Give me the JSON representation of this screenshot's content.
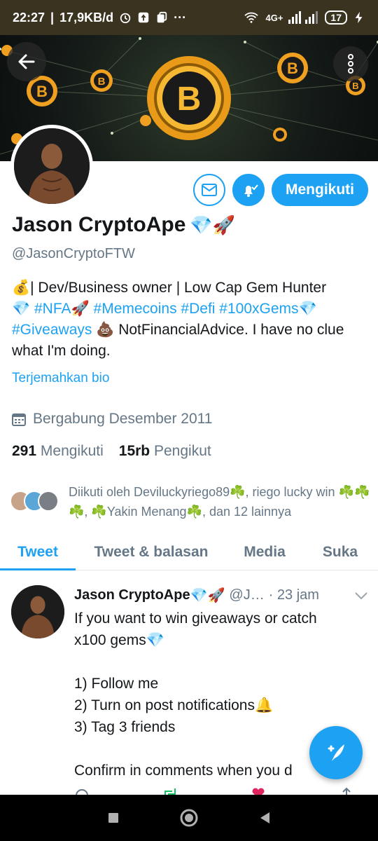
{
  "status_bar": {
    "time": "22:27",
    "net_speed": "17,9KB/d",
    "dots": "···",
    "network": "4G+",
    "battery": "17"
  },
  "banner": {
    "coin_letter": "B"
  },
  "profile": {
    "name": "Jason CryptoApe",
    "name_emojis": "💎🚀",
    "handle": "@JasonCryptoFTW",
    "follow_label": "Mengikuti",
    "bio_line1": "💰| Dev/Business owner | Low Cap Gem Hunter",
    "bio_line2_start": "💎",
    "bio_tag_nfa": "#NFA🚀",
    "bio_tag_memecoins": "#Memecoins",
    "bio_tag_defi": "#Defi",
    "bio_tag_100x": "#100xGems💎",
    "bio_tag_giveaways": "#Giveaways",
    "bio_tail": "💩 NotFinancialAdvice. I have no clue what I'm doing.",
    "translate_label": "Terjemahkan bio",
    "joined": "Bergabung Desember 2011",
    "following_count": "291",
    "following_label": "Mengikuti",
    "followers_count": "15rb",
    "followers_label": "Pengikut",
    "followed_by": "Diikuti oleh Deviluckyriego89☘️, riego lucky win ☘️☘️☘️, ☘️Yakin Menang☘️, dan 12 lainnya"
  },
  "tabs": [
    "Tweet",
    "Tweet & balasan",
    "Media",
    "Suka"
  ],
  "tweet": {
    "name": "Jason CryptoApe",
    "name_emojis": "💎🚀",
    "handle_short": "@J…",
    "time": "· 23 jam",
    "line1": "If you want to win giveaways or catch",
    "line2": "x100 gems💎",
    "line3": "1) Follow me",
    "line4": "2) Turn on post notifications🔔",
    "line5": "3) Tag 3 friends",
    "line6": "Confirm in comments when you d"
  },
  "colors": {
    "accent": "#1da1f2",
    "muted": "#657786",
    "text": "#14171a",
    "coin": "#f0a020"
  }
}
